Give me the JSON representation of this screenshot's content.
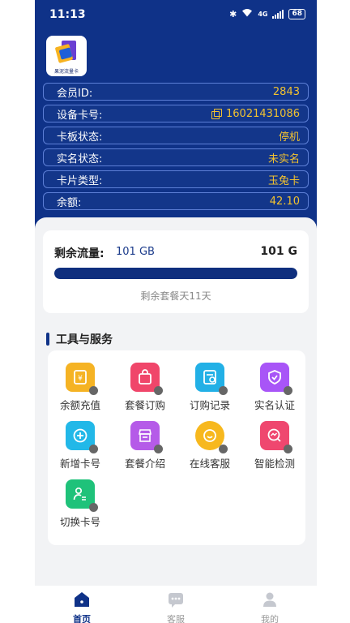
{
  "status_bar": {
    "time": "11:13",
    "network": "4G",
    "battery": "68"
  },
  "app": {
    "logo_text": "果泥流量卡"
  },
  "info": [
    {
      "label": "会员ID:",
      "value": "2843"
    },
    {
      "label": "设备卡号:",
      "value": "16021431086"
    },
    {
      "label": "卡板状态:",
      "value": "停机"
    },
    {
      "label": "实名状态:",
      "value": "未实名"
    },
    {
      "label": "卡片类型:",
      "value": "玉兔卡"
    },
    {
      "label": "余额:",
      "value": "42.10"
    }
  ],
  "data_usage": {
    "label": "剩余流量:",
    "used": "101 GB",
    "total": "101 G",
    "progress_percent": 100,
    "remaining_text": "剩余套餐天11天"
  },
  "tools_section": {
    "title": "工具与服务",
    "items": [
      {
        "label": "余额充值",
        "icon": "wallet-icon",
        "color": "#f5b324"
      },
      {
        "label": "套餐订购",
        "icon": "shopping-bag-icon",
        "color": "#f0466a"
      },
      {
        "label": "订购记录",
        "icon": "order-record-icon",
        "color": "#22b0e6"
      },
      {
        "label": "实名认证",
        "icon": "shield-check-icon",
        "color": "#a855f7"
      },
      {
        "label": "新增卡号",
        "icon": "add-circle-icon",
        "color": "#22b8e8"
      },
      {
        "label": "套餐介绍",
        "icon": "store-icon",
        "color": "#b55be8"
      },
      {
        "label": "在线客服",
        "icon": "chat-bubble-icon",
        "color": "#f7b81e"
      },
      {
        "label": "智能检测",
        "icon": "detect-chart-icon",
        "color": "#ef476f"
      },
      {
        "label": "切换卡号",
        "icon": "switch-user-icon",
        "color": "#1fc27a"
      }
    ]
  },
  "bottom_nav": [
    {
      "label": "首页",
      "icon": "home-icon",
      "active": true
    },
    {
      "label": "客服",
      "icon": "message-icon",
      "active": false
    },
    {
      "label": "我的",
      "icon": "user-icon",
      "active": false
    }
  ],
  "colors": {
    "primary": "#0f3288",
    "accent": "#f2c230"
  }
}
